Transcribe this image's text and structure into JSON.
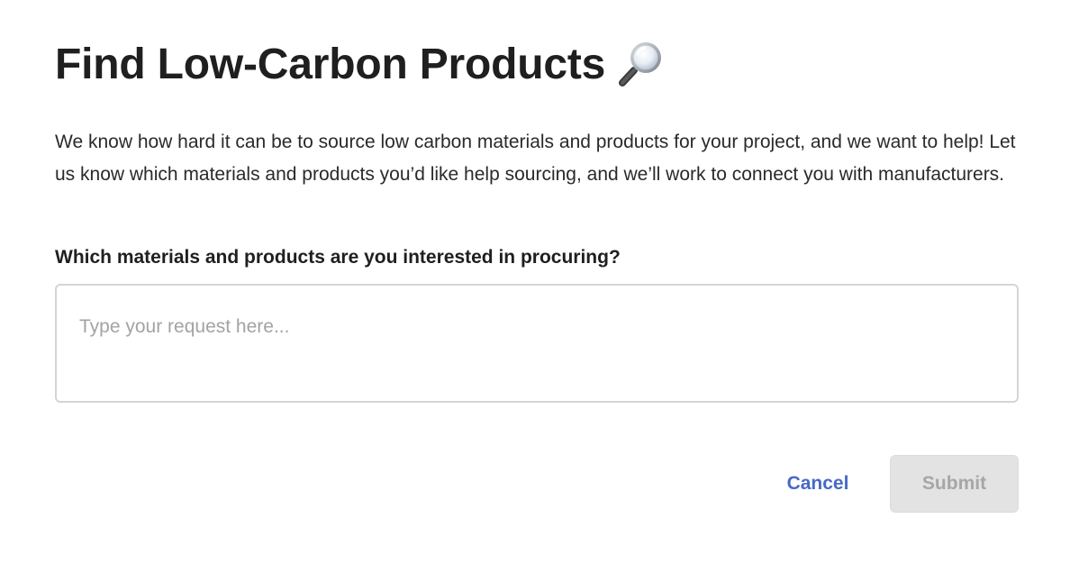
{
  "dialog": {
    "title": "Find Low-Carbon Products",
    "title_icon": "magnifying-glass-icon",
    "description": "We know how hard it can be to source low carbon materials and products for your project, and we want to help! Let us know which materials and products you’d like help sourcing, and we’ll work to connect you with manufacturers.",
    "question": "Which materials and products are you interested in procuring?",
    "request": {
      "value": "",
      "placeholder": "Type your request here..."
    },
    "cancel_label": "Cancel",
    "submit_label": "Submit",
    "submit_disabled": true
  },
  "colors": {
    "link_blue": "#4769c8",
    "disabled_button_bg": "#e3e3e3",
    "disabled_button_text": "#a6a6a6",
    "input_border": "#d5d5d5"
  }
}
